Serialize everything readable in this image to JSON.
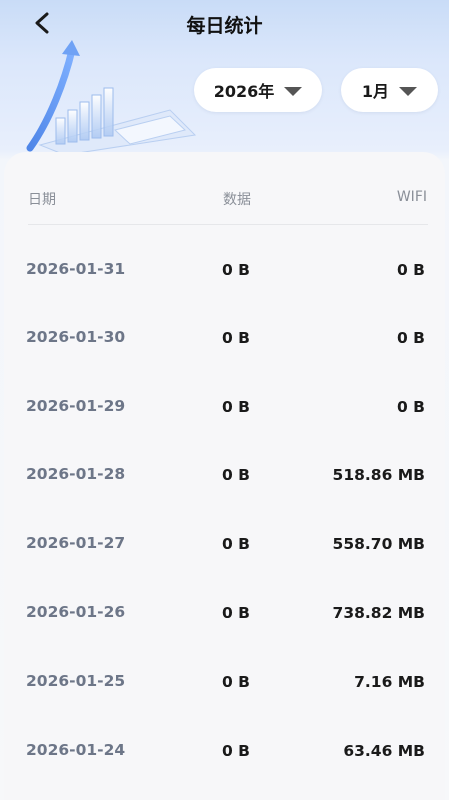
{
  "header": {
    "title": "每日统计",
    "back_icon": "chevron-left-icon"
  },
  "filters": {
    "year": "2026年",
    "month": "1月",
    "dropdown_icon": "triangle-down-icon"
  },
  "table": {
    "columns": [
      "日期",
      "数据",
      "WIFI"
    ],
    "rows": [
      {
        "date": "2026-01-31",
        "data": "0 B",
        "wifi": "0 B"
      },
      {
        "date": "2026-01-30",
        "data": "0 B",
        "wifi": "0 B"
      },
      {
        "date": "2026-01-29",
        "data": "0 B",
        "wifi": "0 B"
      },
      {
        "date": "2026-01-28",
        "data": "0 B",
        "wifi": "518.86 MB"
      },
      {
        "date": "2026-01-27",
        "data": "0 B",
        "wifi": "558.70 MB"
      },
      {
        "date": "2026-01-26",
        "data": "0 B",
        "wifi": "738.82 MB"
      },
      {
        "date": "2026-01-25",
        "data": "0 B",
        "wifi": "7.16 MB"
      },
      {
        "date": "2026-01-24",
        "data": "0 B",
        "wifi": "63.46 MB"
      }
    ]
  },
  "colors": {
    "accent": "#5b8def",
    "header_bg": "#c9dcf7",
    "date_text": "#6d7688",
    "value_text": "#1a1a1a",
    "muted_text": "#8a8f98"
  }
}
